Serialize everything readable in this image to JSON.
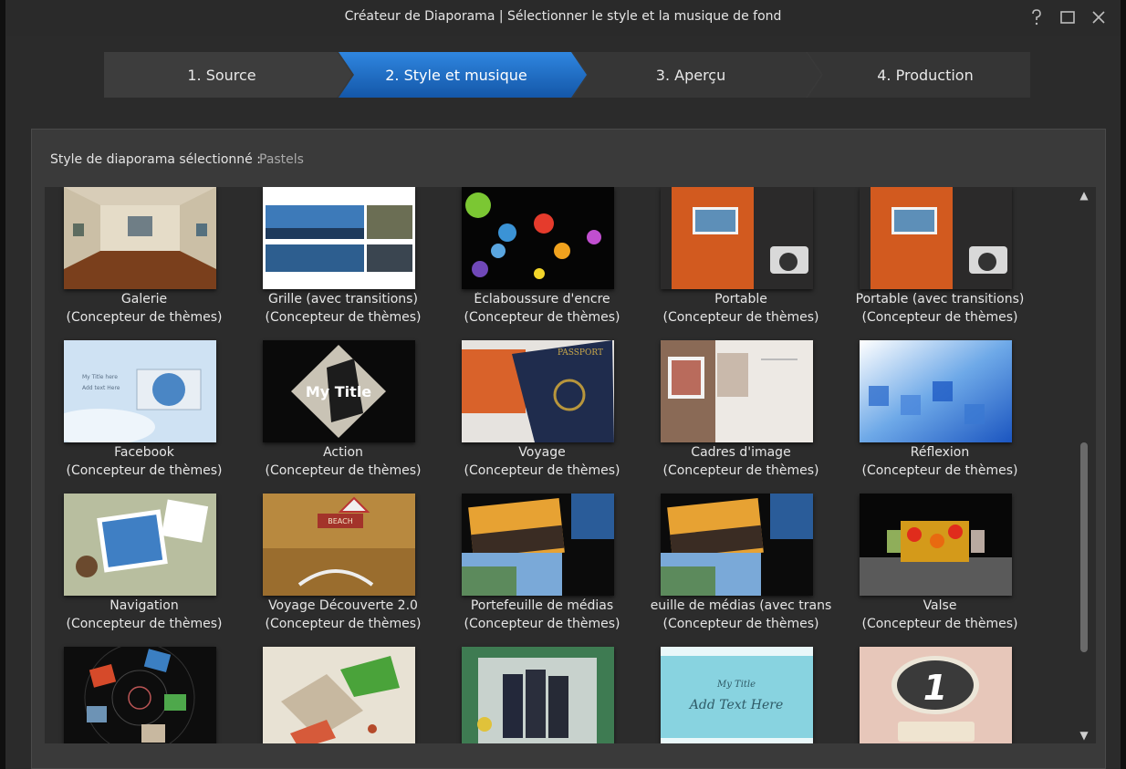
{
  "window": {
    "title": "Créateur de Diaporama | Sélectionner le style et la musique de fond",
    "help_icon": "question-icon",
    "maximize_icon": "maximize-icon",
    "close_icon": "close-icon"
  },
  "wizard": {
    "steps": [
      {
        "label": "1. Source",
        "active": false
      },
      {
        "label": "2. Style et musique",
        "active": true
      },
      {
        "label": "3. Aperçu",
        "active": false
      },
      {
        "label": "4. Production",
        "active": false
      }
    ],
    "active_color": "#1f6cc6"
  },
  "selection": {
    "label": "Style de diaporama sélectionné :",
    "value": "Pastels"
  },
  "styles": [
    {
      "name": "Galerie",
      "sub": "(Concepteur de thèmes)"
    },
    {
      "name": "Grille (avec transitions)",
      "sub": "(Concepteur de thèmes)"
    },
    {
      "name": "Éclaboussure d'encre",
      "sub": "(Concepteur de thèmes)"
    },
    {
      "name": "Portable",
      "sub": "(Concepteur de thèmes)"
    },
    {
      "name": "Portable (avec transitions)",
      "sub": "(Concepteur de thèmes)"
    },
    {
      "name": "Facebook",
      "sub": "(Concepteur de thèmes)",
      "thumb_text": [
        "My Title here",
        "Add text Here"
      ]
    },
    {
      "name": "Action",
      "sub": "(Concepteur de thèmes)",
      "thumb_text": [
        "My Title"
      ]
    },
    {
      "name": "Voyage",
      "sub": "(Concepteur de thèmes)",
      "thumb_text": [
        "PASSPORT"
      ]
    },
    {
      "name": "Cadres d'image",
      "sub": "(Concepteur de thèmes)"
    },
    {
      "name": "Réflexion",
      "sub": "(Concepteur de thèmes)"
    },
    {
      "name": "Navigation",
      "sub": "(Concepteur de thèmes)"
    },
    {
      "name": "Voyage Découverte 2.0",
      "sub": "(Concepteur de thèmes)",
      "thumb_text": [
        "BEACH"
      ]
    },
    {
      "name": "Portefeuille de médias",
      "sub": "(Concepteur de thèmes)"
    },
    {
      "name": "euille de médias (avec trans",
      "sub": "(Concepteur de thèmes)"
    },
    {
      "name": "Valse",
      "sub": "(Concepteur de thèmes)"
    },
    {
      "name": "",
      "sub": ""
    },
    {
      "name": "",
      "sub": ""
    },
    {
      "name": "",
      "sub": ""
    },
    {
      "name": "",
      "sub": "",
      "thumb_text": [
        "My Title",
        "Add Text Here"
      ]
    },
    {
      "name": "",
      "sub": "",
      "thumb_text": [
        "1"
      ]
    }
  ],
  "scroll": {
    "up_glyph": "▲",
    "down_glyph": "▼"
  }
}
